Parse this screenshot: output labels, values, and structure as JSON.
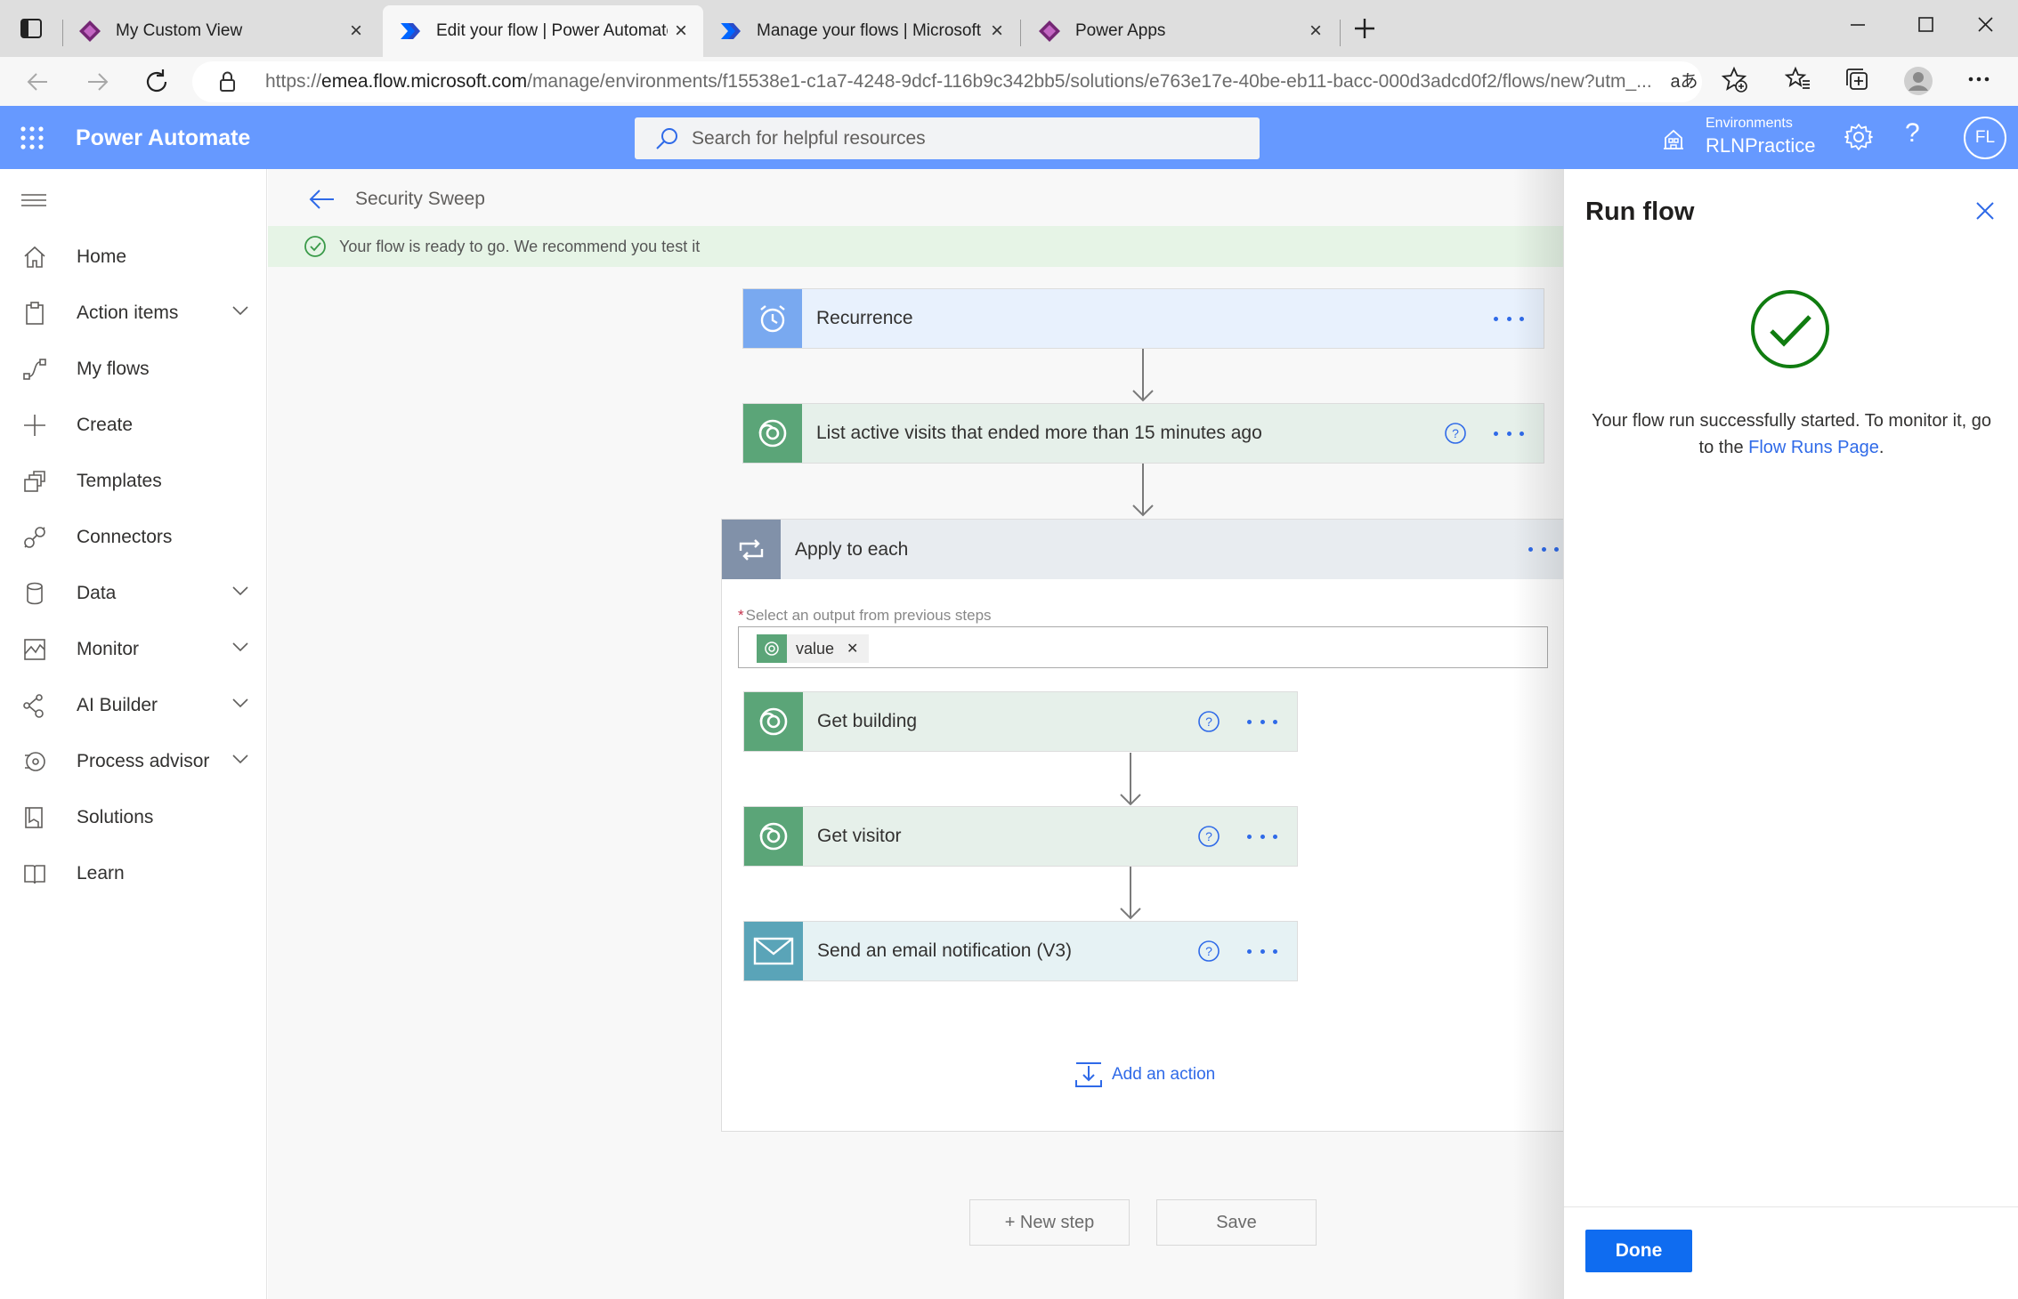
{
  "browser": {
    "tabs": [
      {
        "label": "My Custom View",
        "icon": "power-apps-icon"
      },
      {
        "label": "Edit your flow | Power Automate",
        "icon": "power-automate-icon"
      },
      {
        "label": "Manage your flows | Microsoft Po",
        "icon": "power-automate-icon"
      },
      {
        "label": "Power Apps",
        "icon": "power-apps-icon"
      }
    ],
    "url_prefix": "https://",
    "url_host": "emea.flow.microsoft.com",
    "url_path": "/manage/environments/f15538e1-c1a7-4248-9dcf-116b9c342bb5/solutions/e763e17e-40be-eb11-bacc-000d3adcd0f2/flows/new?utm_..."
  },
  "header": {
    "app_name": "Power Automate",
    "search_placeholder": "Search for helpful resources",
    "environments_label": "Environments",
    "environment_name": "RLNPractice",
    "avatar_initials": "FL",
    "accent_color": "#6699ff"
  },
  "nav": {
    "items": [
      {
        "label": "Home",
        "icon": "home-icon",
        "expandable": false
      },
      {
        "label": "Action items",
        "icon": "clipboard-icon",
        "expandable": true
      },
      {
        "label": "My flows",
        "icon": "flow-icon",
        "expandable": false
      },
      {
        "label": "Create",
        "icon": "plus-icon",
        "expandable": false
      },
      {
        "label": "Templates",
        "icon": "templates-icon",
        "expandable": false
      },
      {
        "label": "Connectors",
        "icon": "connector-icon",
        "expandable": false
      },
      {
        "label": "Data",
        "icon": "database-icon",
        "expandable": true
      },
      {
        "label": "Monitor",
        "icon": "monitor-icon",
        "expandable": true
      },
      {
        "label": "AI Builder",
        "icon": "ai-builder-icon",
        "expandable": true
      },
      {
        "label": "Process advisor",
        "icon": "process-advisor-icon",
        "expandable": true
      },
      {
        "label": "Solutions",
        "icon": "solutions-icon",
        "expandable": false
      },
      {
        "label": "Learn",
        "icon": "book-icon",
        "expandable": false
      }
    ]
  },
  "canvas": {
    "flow_name": "Security Sweep",
    "banner_text": "Your flow is ready to go. We recommend you test it",
    "steps": {
      "recurrence": "Recurrence",
      "list_visits": "List active visits that ended more than 15 minutes ago",
      "apply_to_each": "Apply to each",
      "output_label": "Select an output from previous steps",
      "output_token": "value",
      "get_building": "Get building",
      "get_visitor": "Get visitor",
      "send_email": "Send an email notification (V3)"
    },
    "add_action": "Add an action",
    "new_step": "+ New step",
    "save": "Save"
  },
  "run_panel": {
    "title": "Run flow",
    "message_prefix": "Your flow run successfully started. To monitor it, go to the",
    "message_link": "Flow Runs Page",
    "message_suffix": ".",
    "done": "Done"
  }
}
